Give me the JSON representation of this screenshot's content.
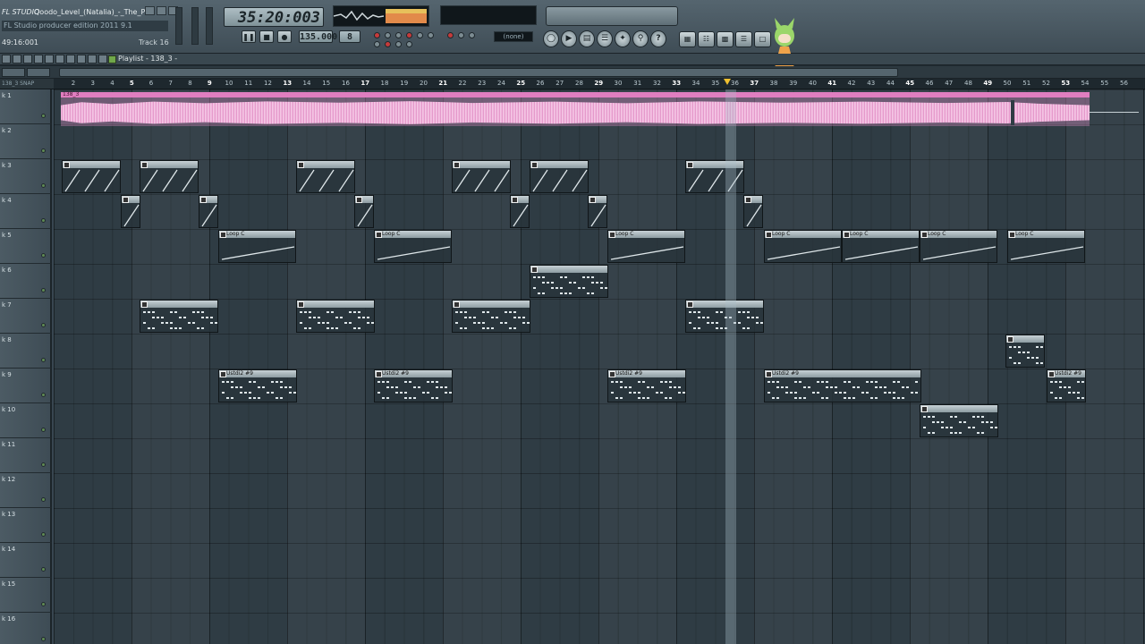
{
  "app": {
    "logo": "FL STUDIO",
    "title": "Qoodo_Level_(Natalia)_-_The_Pri",
    "hint": "FL Studio producer edition 2011 9.1",
    "position": "49:16:001",
    "track_label": "Track 16"
  },
  "transport": {
    "time": "35:20:003",
    "tempo": "135.000",
    "pattern": "8",
    "preset": "(none)",
    "buttons": [
      "pause",
      "stop",
      "record"
    ]
  },
  "toolbar": {
    "playlist_label": "Playlist - 138_3 -"
  },
  "ruler": {
    "bars": [
      "2",
      "3",
      "4",
      "5",
      "6",
      "7",
      "8",
      "9",
      "10",
      "11",
      "12",
      "13",
      "14",
      "15",
      "16",
      "17",
      "18",
      "19",
      "20",
      "21",
      "22",
      "23",
      "24",
      "25",
      "26",
      "27",
      "28",
      "29",
      "30",
      "31",
      "32",
      "33",
      "34",
      "35",
      "36",
      "37",
      "38",
      "39",
      "40",
      "41",
      "42",
      "43",
      "44",
      "45",
      "46",
      "47",
      "48",
      "49",
      "50",
      "51",
      "52",
      "53",
      "54",
      "55",
      "56"
    ],
    "major": [
      "5",
      "9",
      "13",
      "17",
      "21",
      "25",
      "29",
      "33",
      "37",
      "41",
      "45",
      "49",
      "53"
    ],
    "corner": "138_3 SNAP"
  },
  "tracks": [
    {
      "label": "k 1"
    },
    {
      "label": "k 2"
    },
    {
      "label": "k 3"
    },
    {
      "label": "k 4"
    },
    {
      "label": "k 5"
    },
    {
      "label": "k 6"
    },
    {
      "label": "k 7"
    },
    {
      "label": "k 8"
    },
    {
      "label": "k 9"
    },
    {
      "label": "k 10"
    },
    {
      "label": "k 11"
    },
    {
      "label": "k 12"
    },
    {
      "label": "k 13"
    },
    {
      "label": "k 14"
    },
    {
      "label": "k 15"
    },
    {
      "label": "k 16"
    }
  ],
  "audio_clip": {
    "label": "138_3"
  },
  "clip_labels": {
    "loop": "Loop C",
    "pattern": "Ustdi2 #9"
  },
  "colors": {
    "grid": "#2f3c44",
    "audio": "#e59acb",
    "clip_header": "#c7d1d5",
    "playhead": "#f0c030"
  }
}
